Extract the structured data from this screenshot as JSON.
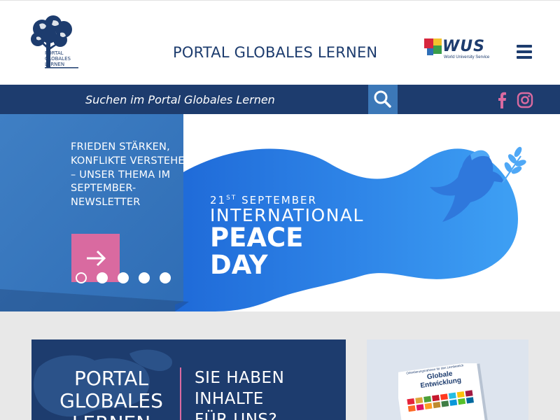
{
  "header": {
    "logo_text": [
      "PORTAL",
      "GLOBALES",
      "LERNEN"
    ],
    "site_title": "PORTAL GLOBALES LERNEN",
    "partner_logo": {
      "name": "WUS",
      "subtitle": "World University Service"
    },
    "menu_icon": "hamburger-icon"
  },
  "search": {
    "placeholder": "Suchen im Portal Globales Lernen",
    "button_icon": "search-icon"
  },
  "social": [
    {
      "name": "facebook-icon",
      "color": "#d96aa0"
    },
    {
      "name": "instagram-icon",
      "color": "#d96aa0"
    }
  ],
  "hero": {
    "teaser": "FRIEDEN STÄRKEN, KONFLIKTE VERSTEHEN – UNSER THEMA IM SEPTEMBER-NEWSLETTER",
    "arrow_icon": "arrow-right-icon",
    "slides": 5,
    "active_slide": 1,
    "image": {
      "date_day": "21",
      "date_suffix": "ST",
      "date_month": "SEPTEMBER",
      "line1": "INTERNATIONAL",
      "line2": "PEACE",
      "line3": "DAY"
    }
  },
  "cards": {
    "left": {
      "portal_text": "PORTAL GLOBALES LERNEN",
      "cta_line1": "SIE HABEN",
      "cta_line2": "INHALTE",
      "cta_line3": "FÜR UNS?"
    },
    "right": {
      "brochure_title": "Globale Entwicklung",
      "brochure_kicker": "Orientierungsrahmen für den Lernbereich"
    }
  },
  "colors": {
    "navy": "#1d3c6e",
    "accent_pink": "#d96aa0",
    "search_button": "#3c78b8",
    "hero_blue": "#2f86e8"
  }
}
